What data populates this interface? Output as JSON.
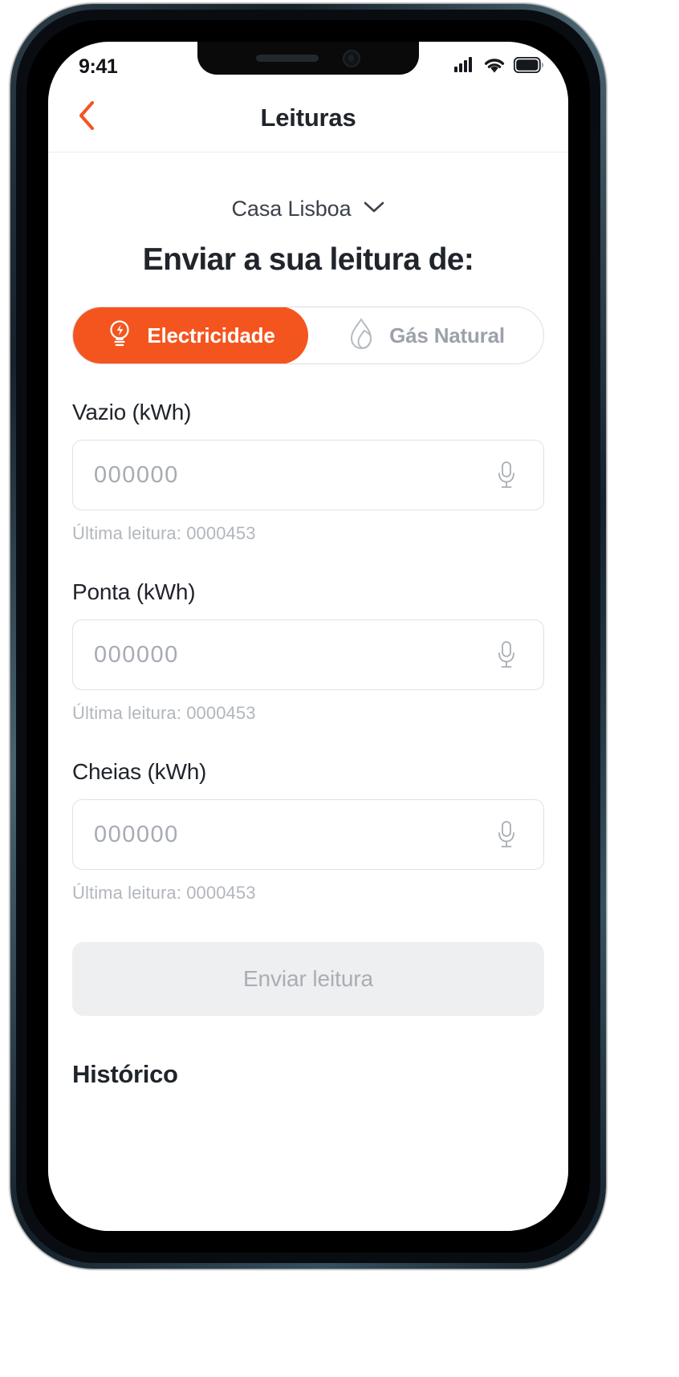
{
  "status_bar": {
    "time": "9:41",
    "cellular_icon": "cellular-bars-icon",
    "wifi_icon": "wifi-icon",
    "battery_icon": "battery-full-icon"
  },
  "nav": {
    "back_icon": "chevron-left-icon",
    "title": "Leituras"
  },
  "house_selector": {
    "name": "Casa Lisboa",
    "chevron_icon": "chevron-down-icon"
  },
  "page_heading": "Enviar a sua leitura de:",
  "segmented_control": {
    "selected": "Electricidade",
    "options": [
      {
        "label": "Electricidade",
        "icon": "lightbulb-icon",
        "active": true
      },
      {
        "label": "Gás Natural",
        "icon": "flame-icon",
        "active": false
      }
    ]
  },
  "fields": [
    {
      "label": "Vazio (kWh)",
      "value": "",
      "placeholder": "000000",
      "mic_icon": "microphone-icon",
      "hint": "Última leitura: 0000453"
    },
    {
      "label": "Ponta (kWh)",
      "value": "",
      "placeholder": "000000",
      "mic_icon": "microphone-icon",
      "hint": "Última leitura: 0000453"
    },
    {
      "label": "Cheias (kWh)",
      "value": "",
      "placeholder": "000000",
      "mic_icon": "microphone-icon",
      "hint": "Última leitura: 0000453"
    }
  ],
  "submit": {
    "label": "Enviar leitura",
    "enabled": false
  },
  "history": {
    "heading": "Histórico"
  },
  "colors": {
    "accent": "#f4551f",
    "text_primary": "#20242b",
    "text_muted": "#b2b6bd",
    "border": "#dfe1e5",
    "disabled_bg": "#eeeff1"
  }
}
